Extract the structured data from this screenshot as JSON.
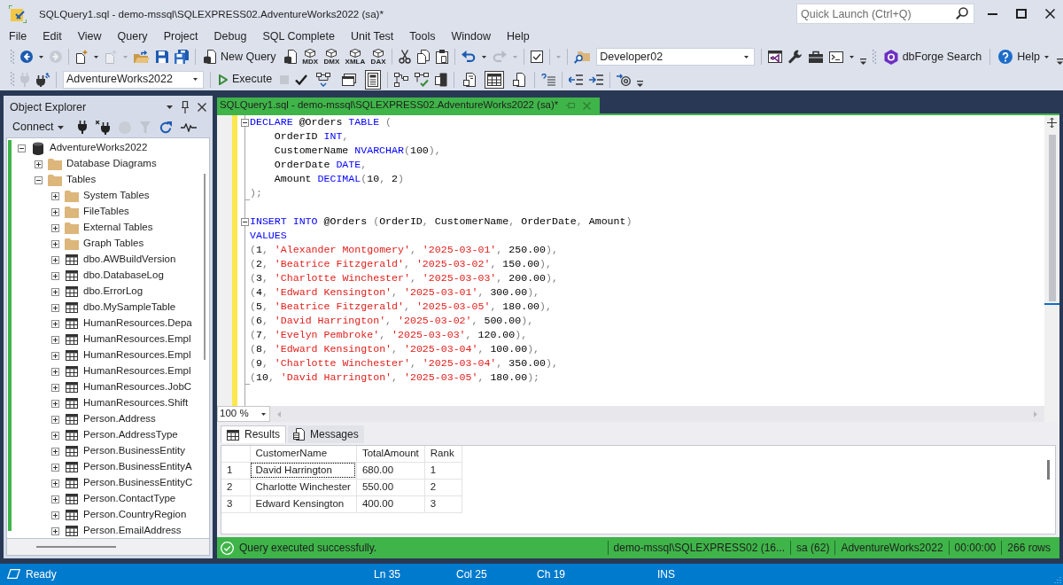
{
  "window": {
    "title": "SQLQuery1.sql - demo-mssql\\SQLEXPRESS02.AdventureWorks2022 (sa)*",
    "quick_launch": {
      "placeholder": "Quick Launch (Ctrl+Q)"
    }
  },
  "menu": [
    "File",
    "Edit",
    "View",
    "Query",
    "Project",
    "Debug",
    "SQL Complete",
    "Unit Test",
    "Tools",
    "Window",
    "Help"
  ],
  "toolbar": {
    "new_query": "New Query",
    "query_types": [
      "MDX",
      "DMX",
      "XMLA",
      "DAX"
    ],
    "profile": "Developer02",
    "search_button": "dbForge Search",
    "help_button": "Help",
    "database": "AdventureWorks2022",
    "execute_button": "Execute",
    "plan_toggles": [
      {
        "on": false
      },
      {
        "on": false
      },
      {
        "on": true
      }
    ],
    "results_modes": [
      {
        "selected": false
      },
      {
        "selected": true
      },
      {
        "selected": false
      }
    ]
  },
  "object_explorer": {
    "title": "Object Explorer",
    "connect_button": "Connect",
    "tree": [
      {
        "label": "AdventureWorks2022",
        "kind": "database",
        "expanded": true,
        "children": [
          {
            "label": "Database Diagrams",
            "kind": "folder",
            "expanded": false
          },
          {
            "label": "Tables",
            "kind": "folder",
            "expanded": true,
            "children": [
              {
                "label": "System Tables",
                "kind": "folder",
                "expanded": false
              },
              {
                "label": "FileTables",
                "kind": "folder",
                "expanded": false
              },
              {
                "label": "External Tables",
                "kind": "folder",
                "expanded": false
              },
              {
                "label": "Graph Tables",
                "kind": "folder",
                "expanded": false
              },
              {
                "label": "dbo.AWBuildVersion",
                "kind": "table",
                "expanded": false
              },
              {
                "label": "dbo.DatabaseLog",
                "kind": "table",
                "expanded": false
              },
              {
                "label": "dbo.ErrorLog",
                "kind": "table",
                "expanded": false
              },
              {
                "label": "dbo.MySampleTable",
                "kind": "table",
                "expanded": false
              },
              {
                "label": "HumanResources.Depa",
                "kind": "table",
                "expanded": false
              },
              {
                "label": "HumanResources.Empl",
                "kind": "table",
                "expanded": false
              },
              {
                "label": "HumanResources.Empl",
                "kind": "table",
                "expanded": false
              },
              {
                "label": "HumanResources.Empl",
                "kind": "table",
                "expanded": false
              },
              {
                "label": "HumanResources.JobC",
                "kind": "table",
                "expanded": false
              },
              {
                "label": "HumanResources.Shift",
                "kind": "table",
                "expanded": false
              },
              {
                "label": "Person.Address",
                "kind": "table",
                "expanded": false
              },
              {
                "label": "Person.AddressType",
                "kind": "table",
                "expanded": false
              },
              {
                "label": "Person.BusinessEntity",
                "kind": "table",
                "expanded": false
              },
              {
                "label": "Person.BusinessEntityA",
                "kind": "table",
                "expanded": false
              },
              {
                "label": "Person.BusinessEntityC",
                "kind": "table",
                "expanded": false
              },
              {
                "label": "Person.ContactType",
                "kind": "table",
                "expanded": false
              },
              {
                "label": "Person.CountryRegion",
                "kind": "table",
                "expanded": false
              },
              {
                "label": "Person.EmailAddress",
                "kind": "table",
                "expanded": false
              }
            ]
          }
        ]
      }
    ]
  },
  "editor": {
    "tab_title": "SQLQuery1.sql - demo-mssql\\SQLEXPRESS02.AdventureWorks2022 (sa)*",
    "lines": [
      {
        "kind": "open",
        "tokens": [
          {
            "kind": "keyword",
            "text": "DECLARE"
          },
          {
            "kind": "plain",
            "text": " @Orders "
          },
          {
            "kind": "keyword",
            "text": "TABLE"
          },
          {
            "kind": "punct",
            "text": " ("
          }
        ]
      },
      {
        "kind": "plain",
        "tokens": [
          {
            "kind": "plain",
            "text": "    OrderID "
          },
          {
            "kind": "keyword",
            "text": "INT"
          },
          {
            "kind": "punct",
            "text": ","
          }
        ]
      },
      {
        "kind": "plain",
        "tokens": [
          {
            "kind": "plain",
            "text": "    CustomerName "
          },
          {
            "kind": "keyword",
            "text": "NVARCHAR"
          },
          {
            "kind": "punct",
            "text": "("
          },
          {
            "kind": "plain",
            "text": "100"
          },
          {
            "kind": "punct",
            "text": "),"
          }
        ]
      },
      {
        "kind": "plain",
        "tokens": [
          {
            "kind": "plain",
            "text": "    OrderDate "
          },
          {
            "kind": "keyword",
            "text": "DATE"
          },
          {
            "kind": "punct",
            "text": ","
          }
        ]
      },
      {
        "kind": "plain",
        "tokens": [
          {
            "kind": "plain",
            "text": "    Amount "
          },
          {
            "kind": "keyword",
            "text": "DECIMAL"
          },
          {
            "kind": "punct",
            "text": "("
          },
          {
            "kind": "plain",
            "text": "10"
          },
          {
            "kind": "punct",
            "text": ", "
          },
          {
            "kind": "plain",
            "text": "2"
          },
          {
            "kind": "punct",
            "text": ")"
          }
        ]
      },
      {
        "kind": "close",
        "tokens": [
          {
            "kind": "punct",
            "text": ");"
          }
        ]
      },
      {
        "kind": "plain"
      },
      {
        "kind": "open",
        "tokens": [
          {
            "kind": "keyword",
            "text": "INSERT INTO"
          },
          {
            "kind": "plain",
            "text": " @Orders "
          },
          {
            "kind": "punct",
            "text": "("
          },
          {
            "kind": "plain",
            "text": "OrderID"
          },
          {
            "kind": "punct",
            "text": ", "
          },
          {
            "kind": "plain",
            "text": "CustomerName"
          },
          {
            "kind": "punct",
            "text": ", "
          },
          {
            "kind": "plain",
            "text": "OrderDate"
          },
          {
            "kind": "punct",
            "text": ", "
          },
          {
            "kind": "plain",
            "text": "Amount"
          },
          {
            "kind": "punct",
            "text": ")"
          }
        ]
      },
      {
        "kind": "plain",
        "tokens": [
          {
            "kind": "keyword",
            "text": "VALUES"
          }
        ]
      },
      {
        "kind": "plain",
        "tokens": [
          {
            "kind": "punct",
            "text": "("
          },
          {
            "kind": "plain",
            "text": "1"
          },
          {
            "kind": "punct",
            "text": ", "
          },
          {
            "kind": "string",
            "text": "'Alexander Montgomery'"
          },
          {
            "kind": "punct",
            "text": ", "
          },
          {
            "kind": "string",
            "text": "'2025-03-01'"
          },
          {
            "kind": "punct",
            "text": ", "
          },
          {
            "kind": "plain",
            "text": "250.00"
          },
          {
            "kind": "punct",
            "text": "),"
          }
        ]
      },
      {
        "kind": "plain",
        "tokens": [
          {
            "kind": "punct",
            "text": "("
          },
          {
            "kind": "plain",
            "text": "2"
          },
          {
            "kind": "punct",
            "text": ", "
          },
          {
            "kind": "string",
            "text": "'Beatrice Fitzgerald'"
          },
          {
            "kind": "punct",
            "text": ", "
          },
          {
            "kind": "string",
            "text": "'2025-03-02'"
          },
          {
            "kind": "punct",
            "text": ", "
          },
          {
            "kind": "plain",
            "text": "150.00"
          },
          {
            "kind": "punct",
            "text": "),"
          }
        ]
      },
      {
        "kind": "plain",
        "tokens": [
          {
            "kind": "punct",
            "text": "("
          },
          {
            "kind": "plain",
            "text": "3"
          },
          {
            "kind": "punct",
            "text": ", "
          },
          {
            "kind": "string",
            "text": "'Charlotte Winchester'"
          },
          {
            "kind": "punct",
            "text": ", "
          },
          {
            "kind": "string",
            "text": "'2025-03-03'"
          },
          {
            "kind": "punct",
            "text": ", "
          },
          {
            "kind": "plain",
            "text": "200.00"
          },
          {
            "kind": "punct",
            "text": "),"
          }
        ]
      },
      {
        "kind": "plain",
        "tokens": [
          {
            "kind": "punct",
            "text": "("
          },
          {
            "kind": "plain",
            "text": "4"
          },
          {
            "kind": "punct",
            "text": ", "
          },
          {
            "kind": "string",
            "text": "'Edward Kensington'"
          },
          {
            "kind": "punct",
            "text": ", "
          },
          {
            "kind": "string",
            "text": "'2025-03-01'"
          },
          {
            "kind": "punct",
            "text": ", "
          },
          {
            "kind": "plain",
            "text": "300.00"
          },
          {
            "kind": "punct",
            "text": "),"
          }
        ]
      },
      {
        "kind": "plain",
        "tokens": [
          {
            "kind": "punct",
            "text": "("
          },
          {
            "kind": "plain",
            "text": "5"
          },
          {
            "kind": "punct",
            "text": ", "
          },
          {
            "kind": "string",
            "text": "'Beatrice Fitzgerald'"
          },
          {
            "kind": "punct",
            "text": ", "
          },
          {
            "kind": "string",
            "text": "'2025-03-05'"
          },
          {
            "kind": "punct",
            "text": ", "
          },
          {
            "kind": "plain",
            "text": "180.00"
          },
          {
            "kind": "punct",
            "text": "),"
          }
        ]
      },
      {
        "kind": "plain",
        "tokens": [
          {
            "kind": "punct",
            "text": "("
          },
          {
            "kind": "plain",
            "text": "6"
          },
          {
            "kind": "punct",
            "text": ", "
          },
          {
            "kind": "string",
            "text": "'David Harrington'"
          },
          {
            "kind": "punct",
            "text": ", "
          },
          {
            "kind": "string",
            "text": "'2025-03-02'"
          },
          {
            "kind": "punct",
            "text": ", "
          },
          {
            "kind": "plain",
            "text": "500.00"
          },
          {
            "kind": "punct",
            "text": "),"
          }
        ]
      },
      {
        "kind": "plain",
        "tokens": [
          {
            "kind": "punct",
            "text": "("
          },
          {
            "kind": "plain",
            "text": "7"
          },
          {
            "kind": "punct",
            "text": ", "
          },
          {
            "kind": "string",
            "text": "'Evelyn Pembroke'"
          },
          {
            "kind": "punct",
            "text": ", "
          },
          {
            "kind": "string",
            "text": "'2025-03-03'"
          },
          {
            "kind": "punct",
            "text": ", "
          },
          {
            "kind": "plain",
            "text": "120.00"
          },
          {
            "kind": "punct",
            "text": "),"
          }
        ]
      },
      {
        "kind": "plain",
        "tokens": [
          {
            "kind": "punct",
            "text": "("
          },
          {
            "kind": "plain",
            "text": "8"
          },
          {
            "kind": "punct",
            "text": ", "
          },
          {
            "kind": "string",
            "text": "'Edward Kensington'"
          },
          {
            "kind": "punct",
            "text": ", "
          },
          {
            "kind": "string",
            "text": "'2025-03-04'"
          },
          {
            "kind": "punct",
            "text": ", "
          },
          {
            "kind": "plain",
            "text": "100.00"
          },
          {
            "kind": "punct",
            "text": "),"
          }
        ]
      },
      {
        "kind": "plain",
        "tokens": [
          {
            "kind": "punct",
            "text": "("
          },
          {
            "kind": "plain",
            "text": "9"
          },
          {
            "kind": "punct",
            "text": ", "
          },
          {
            "kind": "string",
            "text": "'Charlotte Winchester'"
          },
          {
            "kind": "punct",
            "text": ", "
          },
          {
            "kind": "string",
            "text": "'2025-03-04'"
          },
          {
            "kind": "punct",
            "text": ", "
          },
          {
            "kind": "plain",
            "text": "350.00"
          },
          {
            "kind": "punct",
            "text": "),"
          }
        ]
      },
      {
        "kind": "close",
        "tokens": [
          {
            "kind": "punct",
            "text": "("
          },
          {
            "kind": "plain",
            "text": "10"
          },
          {
            "kind": "punct",
            "text": ", "
          },
          {
            "kind": "string",
            "text": "'David Harrington'"
          },
          {
            "kind": "punct",
            "text": ", "
          },
          {
            "kind": "string",
            "text": "'2025-03-05'"
          },
          {
            "kind": "punct",
            "text": ", "
          },
          {
            "kind": "plain",
            "text": "180.00"
          },
          {
            "kind": "punct",
            "text": ");"
          }
        ]
      }
    ],
    "zoom": "100 %"
  },
  "results": {
    "tabs": [
      {
        "label": "Results",
        "selected": true
      },
      {
        "label": "Messages",
        "selected": false
      }
    ],
    "columns": [
      "CustomerName",
      "TotalAmount",
      "Rank"
    ],
    "rows": [
      {
        "number": "1",
        "cells": [
          {
            "text": "David Harrington",
            "selected": true
          },
          {
            "text": "680.00",
            "selected": false
          },
          {
            "text": "1",
            "selected": false
          }
        ]
      },
      {
        "number": "2",
        "cells": [
          {
            "text": "Charlotte Winchester",
            "selected": false
          },
          {
            "text": "550.00",
            "selected": false
          },
          {
            "text": "2",
            "selected": false
          }
        ]
      },
      {
        "number": "3",
        "cells": [
          {
            "text": "Edward Kensington",
            "selected": false
          },
          {
            "text": "400.00",
            "selected": false
          },
          {
            "text": "3",
            "selected": false
          }
        ]
      }
    ]
  },
  "query_status": {
    "message": "Query executed successfully.",
    "segments": [
      "demo-mssql\\SQLEXPRESS02 (16...",
      "sa (62)",
      "AdventureWorks2022",
      "00:00:00",
      "266 rows"
    ]
  },
  "status_bar": {
    "state": "Ready",
    "line": "Ln 35",
    "column": "Col 25",
    "char": "Ch 19",
    "mode": "INS"
  }
}
